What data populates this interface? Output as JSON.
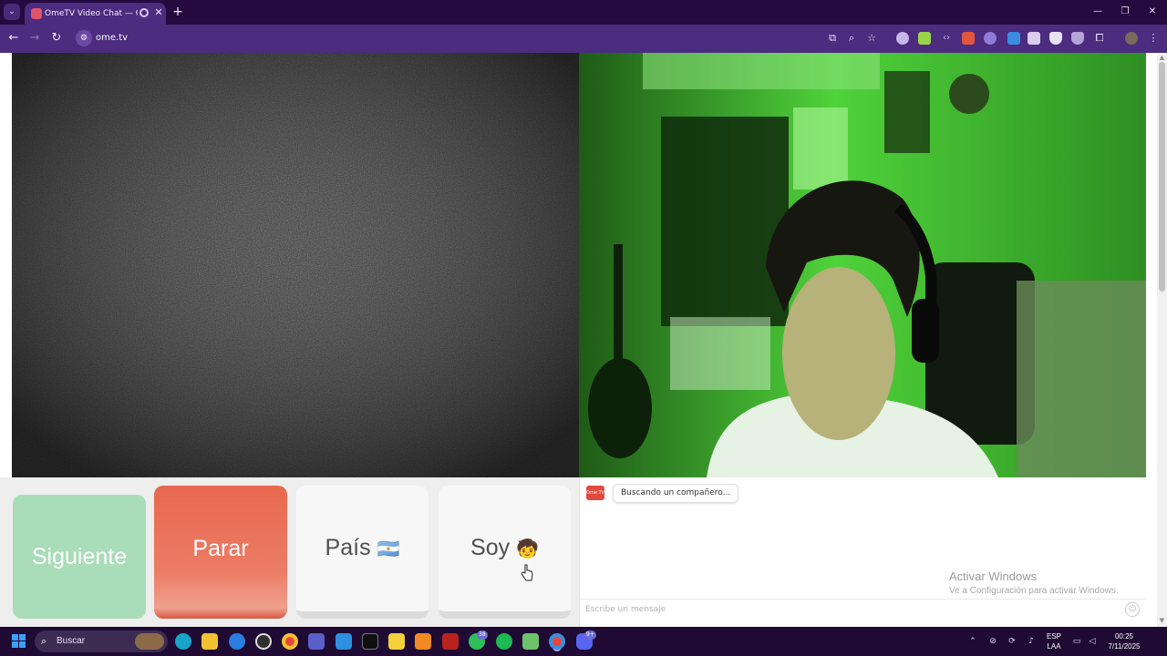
{
  "browser": {
    "tab": {
      "title": "OmeTV Video Chat — Ome",
      "close": "✕"
    },
    "new_tab": "+",
    "window_controls": {
      "minimize": "—",
      "restore": "❐",
      "close": "✕"
    },
    "nav": {
      "back": "←",
      "forward": "→",
      "reload": "↻"
    },
    "address": {
      "url": "ome.tv"
    },
    "omnibox_icons": [
      "install-app-icon",
      "zoom-icon",
      "bookmark-star-icon"
    ],
    "extension_icons": [
      "extension-1-icon",
      "extension-2-icon",
      "extension-3-icon",
      "extension-4-icon",
      "extension-5-icon",
      "extension-6-icon",
      "extension-7-icon",
      "extension-8-icon",
      "extension-9-icon",
      "extensions-puzzle-icon",
      "profile-avatar",
      "menu-icon"
    ]
  },
  "page": {
    "buttons": {
      "next": "Siguiente",
      "stop": "Parar",
      "country": "País",
      "country_flag": "🇦🇷",
      "gender": "Soy",
      "gender_emoji": "🧒"
    },
    "chat": {
      "logo": "Ome TV",
      "status": "Buscando un compañero...",
      "placeholder": "Escribe un mensaje",
      "emoji_icon": "☺"
    },
    "watermark": {
      "title": "Activar Windows",
      "subtitle": "Ve a Configuración para activar Windows."
    }
  },
  "taskbar": {
    "search_label": "Buscar",
    "apps": [
      "edge-icon",
      "file-explorer-icon",
      "app-icon",
      "obs-icon",
      "chrome-icon",
      "teams-icon",
      "vscode-icon",
      "terminal-icon",
      "sticky-notes-icon",
      "xampp-icon",
      "filezilla-icon",
      "whatsapp-icon",
      "spotify-icon",
      "notepad-icon",
      "chrome-active-icon",
      "discord-icon"
    ],
    "badges": {
      "whatsapp": "38",
      "discord": "9+"
    },
    "language": {
      "line1": "ESP",
      "line2": "LAA"
    },
    "clock": {
      "time": "00:25",
      "date": "7/11/2025"
    }
  },
  "colors": {
    "next_button": "#a9dcb8",
    "stop_button": "#e8684e",
    "tabbar": "#240a3e",
    "toolbar": "#4b2c7f",
    "taskbar": "#1e0a33"
  }
}
